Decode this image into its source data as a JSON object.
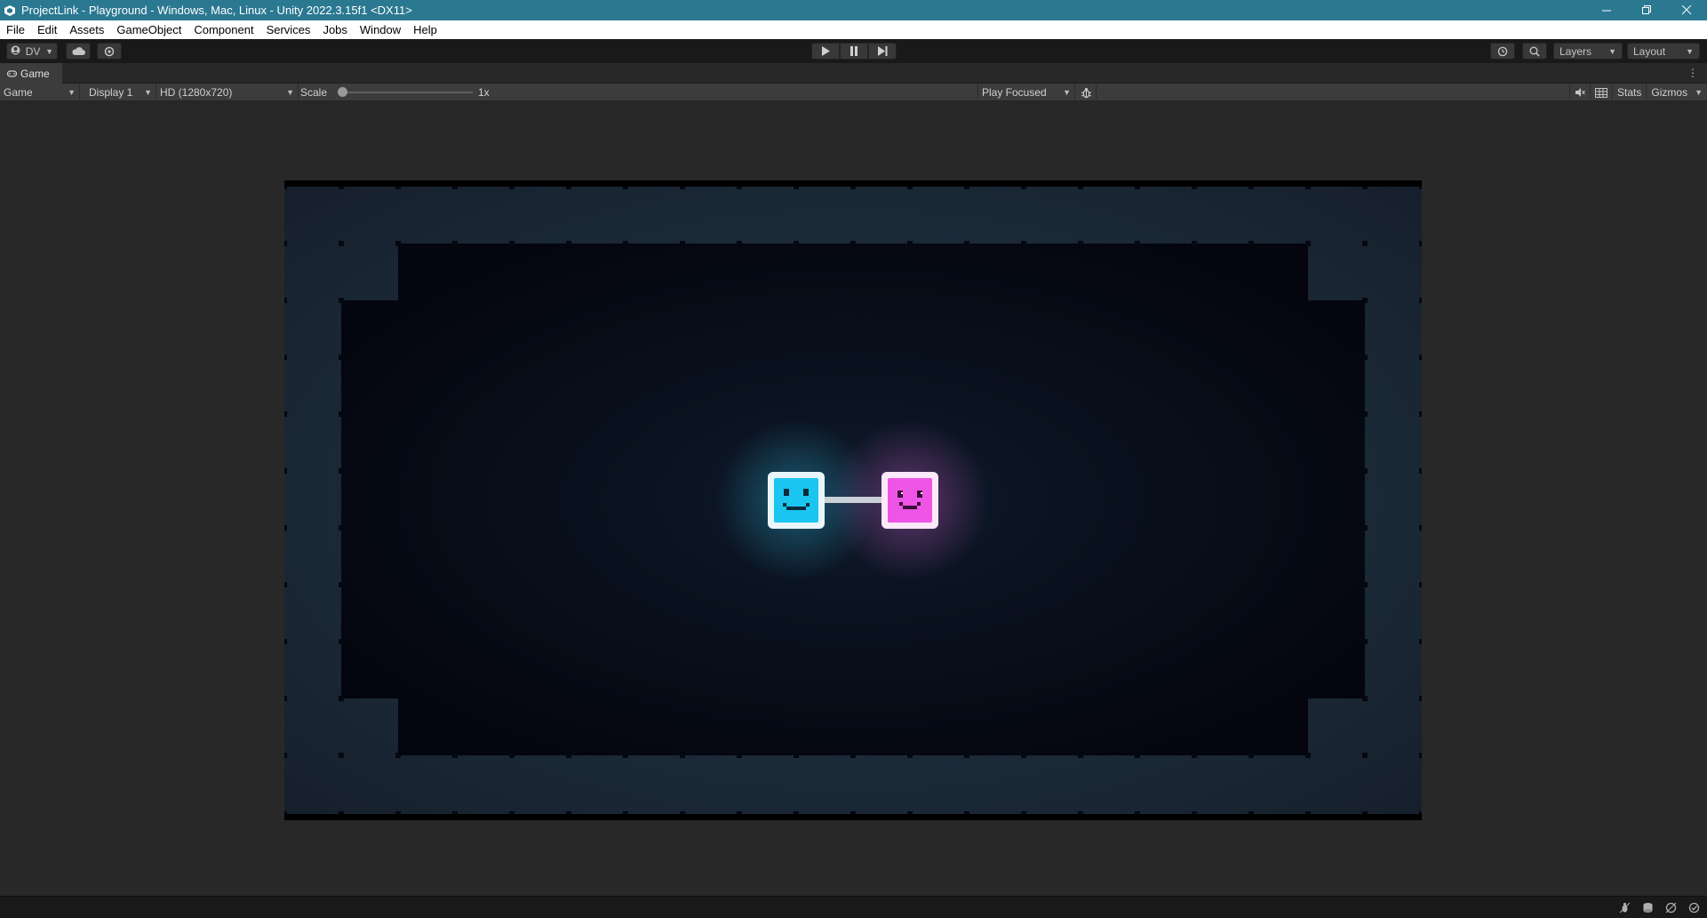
{
  "window": {
    "title": "ProjectLink - Playground - Windows, Mac, Linux - Unity 2022.3.15f1 <DX11>",
    "controls": [
      "minimize",
      "restore",
      "close"
    ]
  },
  "menu": {
    "items": [
      "File",
      "Edit",
      "Assets",
      "GameObject",
      "Component",
      "Services",
      "Jobs",
      "Window",
      "Help"
    ]
  },
  "toolbar": {
    "account_label": "DV",
    "layers_label": "Layers",
    "layout_label": "Layout",
    "play_buttons": [
      "play-icon",
      "pause-icon",
      "step-icon"
    ]
  },
  "tab": {
    "label": "Game"
  },
  "game_toolbar": {
    "view_mode": "Game",
    "display": "Display 1",
    "resolution": "HD (1280x720)",
    "scale_label": "Scale",
    "scale_value": "1x",
    "scale_fraction": 0.0,
    "play_mode": "Play Focused",
    "stats_label": "Stats",
    "gizmos_label": "Gizmos"
  },
  "scene": {
    "background_color": "#05060f",
    "wall_color": "#1e2c3a",
    "characters": [
      {
        "name": "blue-cube",
        "color": "#1ac6f0",
        "glow": "#38d8ff"
      },
      {
        "name": "pink-cube",
        "color": "#ee55e6",
        "glow": "#ff6ef2"
      }
    ],
    "link_color": "#c9d0d8"
  },
  "colors": {
    "titlebar": "#2b7891",
    "accent_blue": "#1ac6f0",
    "accent_pink": "#ee55e6"
  }
}
